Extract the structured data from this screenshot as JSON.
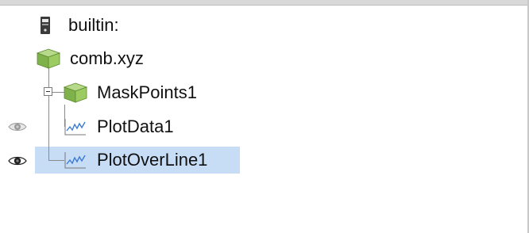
{
  "pipeline_browser": {
    "items": [
      {
        "label": "builtin:",
        "icon": "server-icon",
        "visible": null,
        "selected": false
      },
      {
        "label": "comb.xyz",
        "icon": "source-cube-icon",
        "visible": null,
        "selected": false
      },
      {
        "label": "MaskPoints1",
        "icon": "filter-cube-icon",
        "visible": null,
        "selected": false,
        "expanded": true
      },
      {
        "label": "PlotData1",
        "icon": "line-plot-icon",
        "visible": false,
        "selected": false
      },
      {
        "label": "PlotOverLine1",
        "icon": "line-plot-icon",
        "visible": true,
        "selected": true
      }
    ]
  },
  "colors": {
    "selection": "#c7dcf5",
    "cube_green": "#7fb24a",
    "plot_line": "#3b7bd6",
    "eye_active": "#222222",
    "eye_inactive": "#9a9a9a"
  }
}
